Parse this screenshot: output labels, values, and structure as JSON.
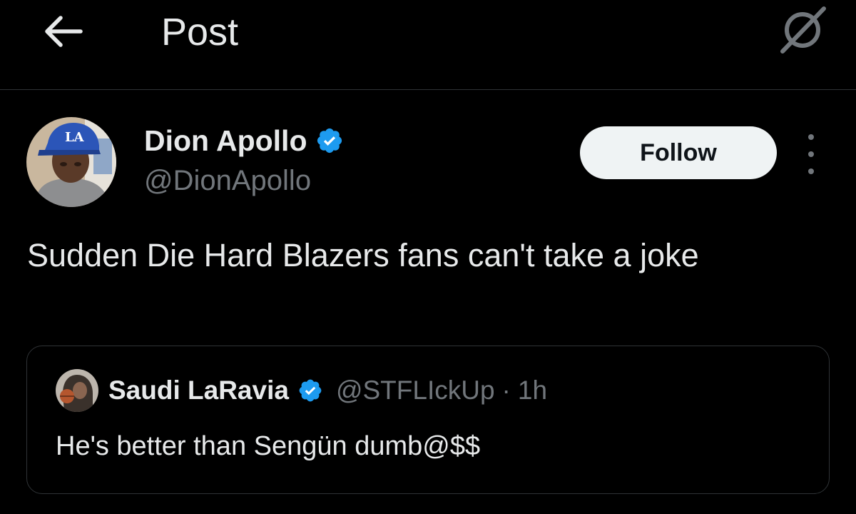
{
  "header": {
    "title": "Post",
    "back_icon": "arrow-left-icon",
    "grok_icon": "grok-icon"
  },
  "post": {
    "author": {
      "display_name": "Dion Apollo",
      "handle": "@DionApollo",
      "verified": true,
      "verified_color": "#1d9bf0"
    },
    "follow_label": "Follow",
    "more_icon": "more-vertical-icon",
    "text": "Sudden Die Hard Blazers fans can't take a joke"
  },
  "quote": {
    "author": {
      "display_name": "Saudi LaRavia",
      "handle": "@STFLIckUp",
      "verified": true
    },
    "separator": "·",
    "time": "1h",
    "text": "He's better than Sengün dumb@$$"
  },
  "colors": {
    "background": "#000000",
    "text_primary": "#e7e9ea",
    "text_secondary": "#71767b",
    "border": "#2f3336",
    "verified_blue": "#1d9bf0",
    "follow_bg": "#eff3f4"
  }
}
